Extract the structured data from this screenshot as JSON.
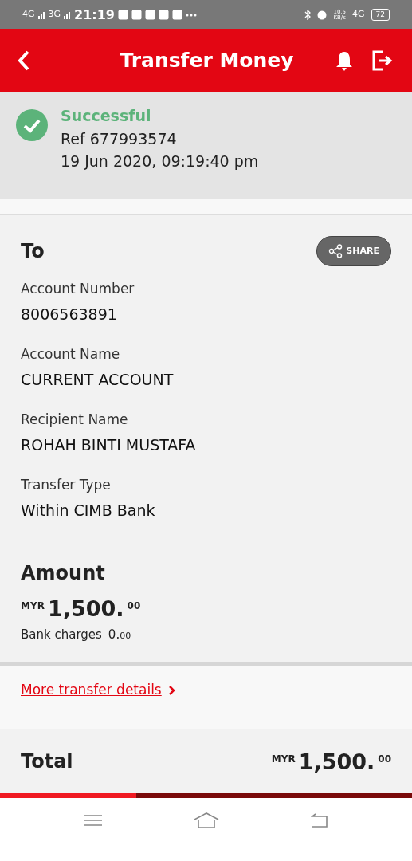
{
  "status_bar": {
    "net_1": "4G",
    "net_2": "3G",
    "time": "21:19",
    "speed": "10.5",
    "speed_unit": "KB/s",
    "net_3": "4G",
    "battery": "72"
  },
  "header": {
    "title": "Transfer Money"
  },
  "result": {
    "status": "Successful",
    "ref": "Ref 677993574",
    "datetime": "19 Jun 2020, 09:19:40 pm"
  },
  "to": {
    "heading": "To",
    "share_label": "SHARE",
    "fields": [
      {
        "label": "Account Number",
        "value": "8006563891"
      },
      {
        "label": "Account Name",
        "value": "CURRENT ACCOUNT"
      },
      {
        "label": "Recipient Name",
        "value": "ROHAH BINTI MUSTAFA"
      },
      {
        "label": "Transfer Type",
        "value": "Within CIMB Bank"
      }
    ]
  },
  "amount": {
    "heading": "Amount",
    "currency": "MYR",
    "whole": "1,500.",
    "cents": "00",
    "charges_label": "Bank charges",
    "charges_whole": "0.",
    "charges_cents": "00"
  },
  "more_link": "More transfer details",
  "total": {
    "label": "Total",
    "currency": "MYR",
    "whole": "1,500.",
    "cents": "00"
  },
  "progress": {
    "level": 0.33
  }
}
